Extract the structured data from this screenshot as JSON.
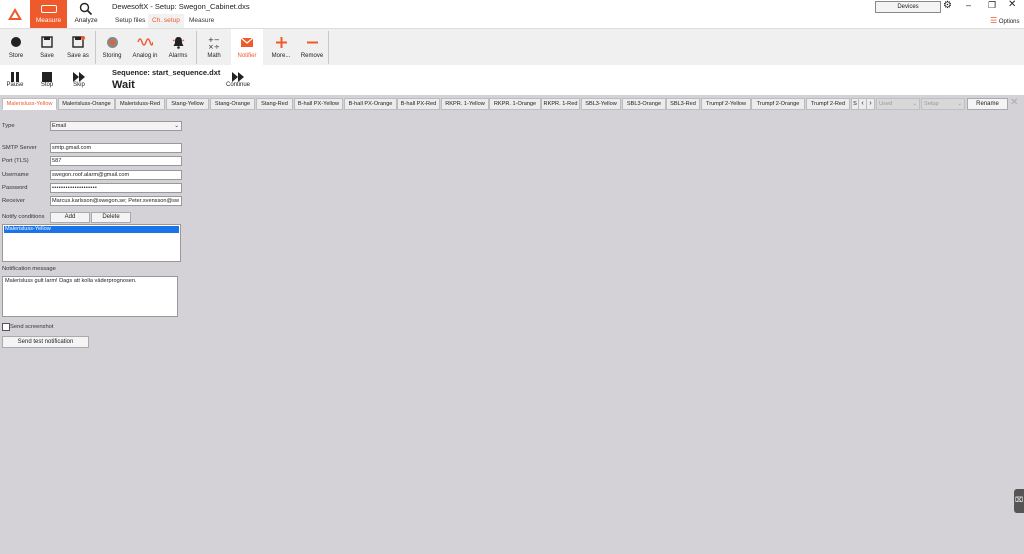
{
  "header": {
    "app_title": "DewesoftX - Setup: Swegon_Cabinet.dxs",
    "measure_label": "Measure",
    "analyze_label": "Analyze",
    "subtabs": [
      "Setup files",
      "Ch. setup",
      "Measure"
    ],
    "devices_label": "Devices",
    "options_label": "Options"
  },
  "toolbar": {
    "store": "Store",
    "save": "Save",
    "save_as": "Save as",
    "storing": "Storing",
    "analog_in": "Analog in",
    "alarms": "Alarms",
    "math": "Math",
    "notifier": "Notifier",
    "more": "More...",
    "remove": "Remove"
  },
  "sequence": {
    "pause": "Pause",
    "stop": "Stop",
    "skip": "Skip",
    "name": "Sequence: start_sequence.dxt",
    "state": "Wait",
    "continue": "Continue"
  },
  "channel_tabs": [
    "Malerisluss-Yellow",
    "Malerisluss-Orange",
    "Malerisluss-Red",
    "Stang-Yellow",
    "Stang-Orange",
    "Stang-Red",
    "B-hall PX-Yellow",
    "B-hall PX-Orange",
    "B-hall PX-Red",
    "RKPR. 1-Yellow",
    "RKPR. 1-Orange",
    "RKPR. 1-Red",
    "SBL3-Yellow",
    "SBL3-Orange",
    "SBL3-Red",
    "Trumpf 2-Yellow",
    "Trumpf 2-Orange",
    "Trumpf 2-Red",
    "S"
  ],
  "tab_controls": {
    "used": "Used",
    "setup": "Setup",
    "rename": "Rename"
  },
  "form": {
    "type_label": "Type",
    "type_value": "Email",
    "smtp_label": "SMTP Server",
    "smtp_value": "smtp.gmail.com",
    "port_label": "Port (TLS)",
    "port_value": "587",
    "username_label": "Username",
    "username_value": "swegon.roof.alarm@gmail.com",
    "password_label": "Password",
    "password_value": "••••••••••••••••••••",
    "receiver_label": "Receiver",
    "receiver_value": "Marcus.karlsson@swegon.se; Peter.svensson@sw",
    "notify_label": "Notify conditions",
    "add_label": "Add",
    "delete_label": "Delete",
    "condition_item": "Malerisluss-Yellow",
    "message_label": "Notification message",
    "message_value": "Malerisluss gult larm! Dags att kolla väderprognosen.",
    "screenshot_label": "Send screenshot",
    "test_label": "Send test notification"
  },
  "colors": {
    "accent": "#ee5a2b",
    "selection": "#1a73e8"
  }
}
